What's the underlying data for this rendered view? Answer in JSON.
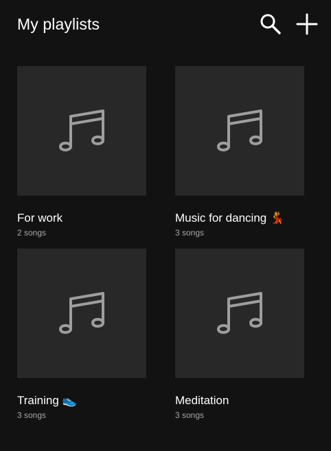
{
  "header": {
    "title": "My playlists",
    "search_icon": "search-icon",
    "add_icon": "plus-icon"
  },
  "colors": {
    "background": "#121212",
    "thumbnail": "#282828",
    "icon": "#9e9e9e",
    "subtitle": "#a7a7a7"
  },
  "playlists": [
    {
      "title": "For work",
      "songs": "2 songs",
      "icon": "music-note-icon"
    },
    {
      "title": "Music for dancing 💃",
      "songs": "3 songs",
      "icon": "music-note-icon"
    },
    {
      "title": "Training 👟",
      "songs": "3 songs",
      "icon": "music-note-icon"
    },
    {
      "title": "Meditation",
      "songs": "3 songs",
      "icon": "music-note-icon"
    }
  ]
}
